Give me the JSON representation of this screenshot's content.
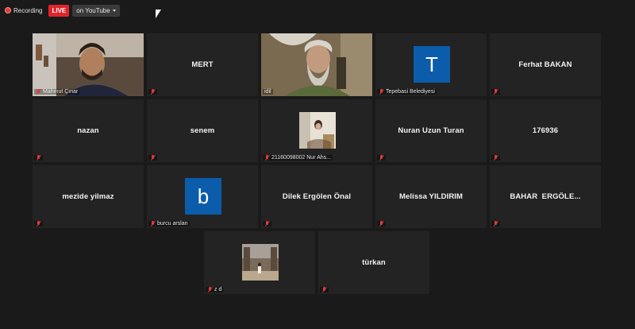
{
  "topbar": {
    "recording_label": "Recording",
    "live_label": "LIVE",
    "stream_label": "on YouTube"
  },
  "colors": {
    "background": "#1a1a1a",
    "tile": "#232323",
    "live": "#e0242b",
    "active_speaker": "#9ad43b",
    "avatar": "#0b5cab",
    "muted": "#e23a3a"
  },
  "participants": [
    {
      "name": "Mahmut Çınar",
      "video": true
    },
    {
      "name": "MERT"
    },
    {
      "name": "idil",
      "video": true,
      "active": true
    },
    {
      "name": "Tepebasi Belediyesi",
      "avatar_letter": "T"
    },
    {
      "name": "Ferhat BAKAN"
    },
    {
      "name": "nazan"
    },
    {
      "name": "senem"
    },
    {
      "name": "21160098002 Nur Ahs...",
      "photo": true
    },
    {
      "name": "Nuran Uzun Turan"
    },
    {
      "name": "176936"
    },
    {
      "name": "mezide yilmaz"
    },
    {
      "name": "burcu arslan",
      "avatar_letter": "b"
    },
    {
      "name": "Dilek Ergölen Önal"
    },
    {
      "name": "Melissa YILDIRIM"
    },
    {
      "name": "BAHAR  ERGÖLE..."
    },
    {
      "name": "z d",
      "photo": true
    },
    {
      "name": "türkan"
    }
  ]
}
